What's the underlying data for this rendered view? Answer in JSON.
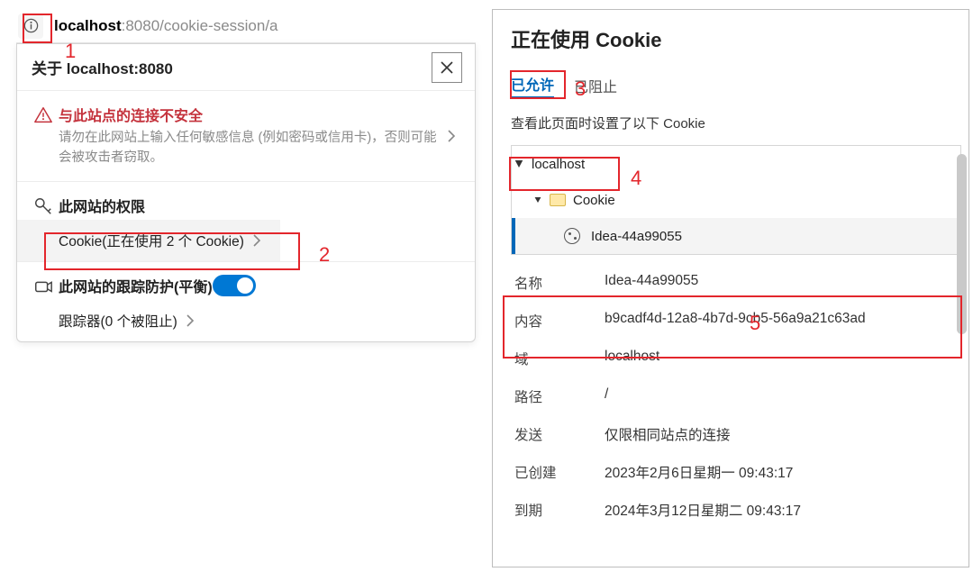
{
  "callouts": {
    "1": "1",
    "2": "2",
    "3": "3",
    "4": "4",
    "5": "5"
  },
  "addrbar": {
    "host": "localhost",
    "port": ":8080",
    "path": "/cookie-session/a"
  },
  "left": {
    "about_prefix": "关于 ",
    "about_host": "localhost:8080",
    "insecure_title": "与此站点的连接不安全",
    "insecure_desc": "请勿在此网站上输入任何敏感信息 (例如密码或信用卡)，否则可能会被攻击者窃取。",
    "perm_title": "此网站的权限",
    "cookie_row": "Cookie(正在使用 2 个 Cookie)",
    "tracking_title": "此网站的跟踪防护(平衡)",
    "tracker_row": "跟踪器(0 个被阻止)"
  },
  "right": {
    "title": "正在使用 Cookie",
    "tab_allowed": "已允许",
    "tab_blocked": "已阻止",
    "desc": "查看此页面时设置了以下 Cookie",
    "tree_host": "localhost",
    "tree_cookie": "Cookie",
    "tree_item": "Idea-44a99055",
    "labels": {
      "name": "名称",
      "content": "内容",
      "domain": "域",
      "path": "路径",
      "send": "发送",
      "created": "已创建",
      "expires": "到期"
    },
    "values": {
      "name": "Idea-44a99055",
      "content": "b9cadf4d-12a8-4b7d-9cb5-56a9a21c63ad",
      "domain": "localhost",
      "path": "/",
      "send": "仅限相同站点的连接",
      "created": "2023年2月6日星期一 09:43:17",
      "expires": "2024年3月12日星期二 09:43:17"
    }
  }
}
